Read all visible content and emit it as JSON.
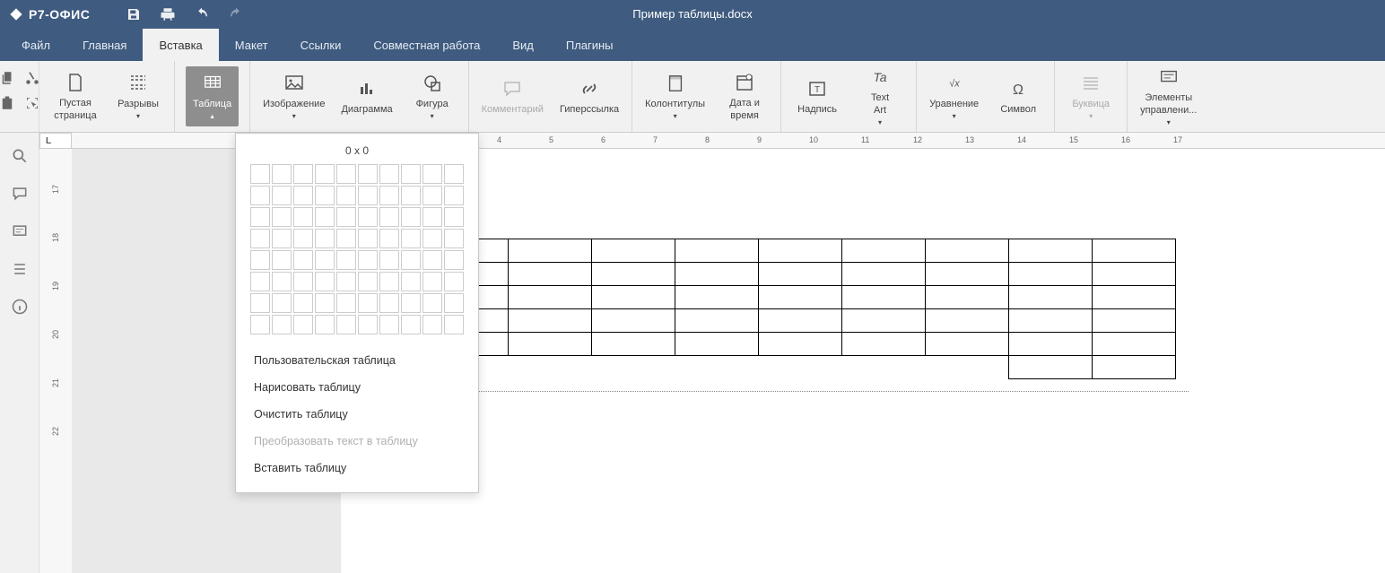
{
  "app": {
    "name": "Р7-ОФИС",
    "document_title": "Пример таблицы.docx"
  },
  "menu": {
    "items": [
      "Файл",
      "Главная",
      "Вставка",
      "Макет",
      "Ссылки",
      "Совместная работа",
      "Вид",
      "Плагины"
    ],
    "active_index": 2
  },
  "ribbon": {
    "blank_page": "Пустая\nстраница",
    "breaks": "Разрывы",
    "table": "Таблица",
    "image": "Изображение",
    "chart": "Диаграмма",
    "shape": "Фигура",
    "comment": "Комментарий",
    "hyperlink": "Гиперссылка",
    "header_footer": "Колонтитулы",
    "date_time": "Дата и\nвремя",
    "caption": "Надпись",
    "text_art": "Text\nArt",
    "equation": "Уравнение",
    "symbol": "Символ",
    "dropcap": "Буквица",
    "controls": "Элементы\nуправлени..."
  },
  "table_dropdown": {
    "size_label": "0 x 0",
    "grid_cols": 10,
    "grid_rows": 8,
    "menu": [
      {
        "label": "Пользовательская таблица",
        "enabled": true
      },
      {
        "label": "Нарисовать таблицу",
        "enabled": true
      },
      {
        "label": "Очистить таблицу",
        "enabled": true
      },
      {
        "label": "Преобразовать текст в таблицу",
        "enabled": false
      },
      {
        "label": "Вставить таблицу",
        "enabled": true
      }
    ]
  },
  "document": {
    "table_rows": 5,
    "table_cols": 10,
    "extra_cell_row": true
  },
  "ruler": {
    "h_start": -2,
    "h_end": 17,
    "v_values": [
      17,
      18,
      19,
      20,
      21,
      22
    ]
  }
}
